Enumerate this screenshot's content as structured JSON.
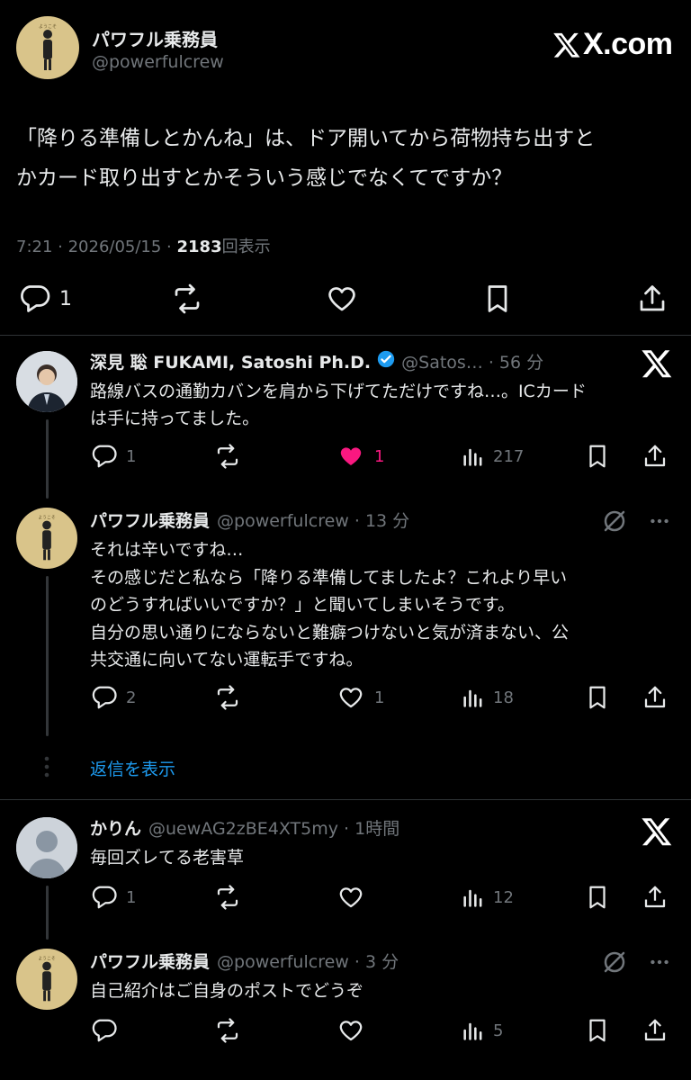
{
  "colors": {
    "background": "#000000",
    "text": "#e7e9ea",
    "muted": "#71767b",
    "link": "#1d9bf0",
    "like": "#f91880",
    "verified": "#1d9bf0"
  },
  "header": {
    "brand": "X.com"
  },
  "main_post": {
    "name": "パワフル乗務員",
    "handle": "@powerfulcrew",
    "avatar": "powerfulcrew-avatar",
    "text_line1": "「降りる準備しとかんね」は、ドア開いてから荷物持ち出すと",
    "text_line2": "かカード取り出すとかそういう感じでなくてですか？",
    "time": "7:21 · 2026/05/15 · ",
    "views": "2183",
    "views_label": "回表示",
    "replies": "1"
  },
  "replies": [
    {
      "name": "深見 聡 FUKAMI, Satoshi Ph.D.",
      "handle": "@Satos… · 56 分",
      "text_line1": "路線バスの通勤カバンを肩から下げてただけですね…。ICカード",
      "text_line2": "は手に持ってました。",
      "replies": "1",
      "likes": "1",
      "views": "217"
    },
    {
      "name": "パワフル乗務員",
      "handle": "@powerfulcrew · 13 分",
      "text_line1": "それは辛いですね…",
      "text_line2": "その感じだと私なら「降りる準備してましたよ？これより早い",
      "text_line3": "のどうすればいいですか？」と聞いてしまいそうです。",
      "text_line4": "自分の思い通りにならないと難癖つけないと気が済まない、公",
      "text_line5": "共交通に向いてない運転手ですね。",
      "replies": "2",
      "likes": "1",
      "views": "18"
    },
    {
      "name": "かりん",
      "handle": "@uewAG2zBE4XT5my · 1時間",
      "text_line1": "毎回ズレてる老害草",
      "replies": "1",
      "views": "12"
    },
    {
      "name": "パワフル乗務員",
      "handle": "@powerfulcrew · 3 分",
      "text_line1": "自己紹介はご自身のポストでどうぞ",
      "views": "5"
    }
  ],
  "show_replies": "返信を表示"
}
